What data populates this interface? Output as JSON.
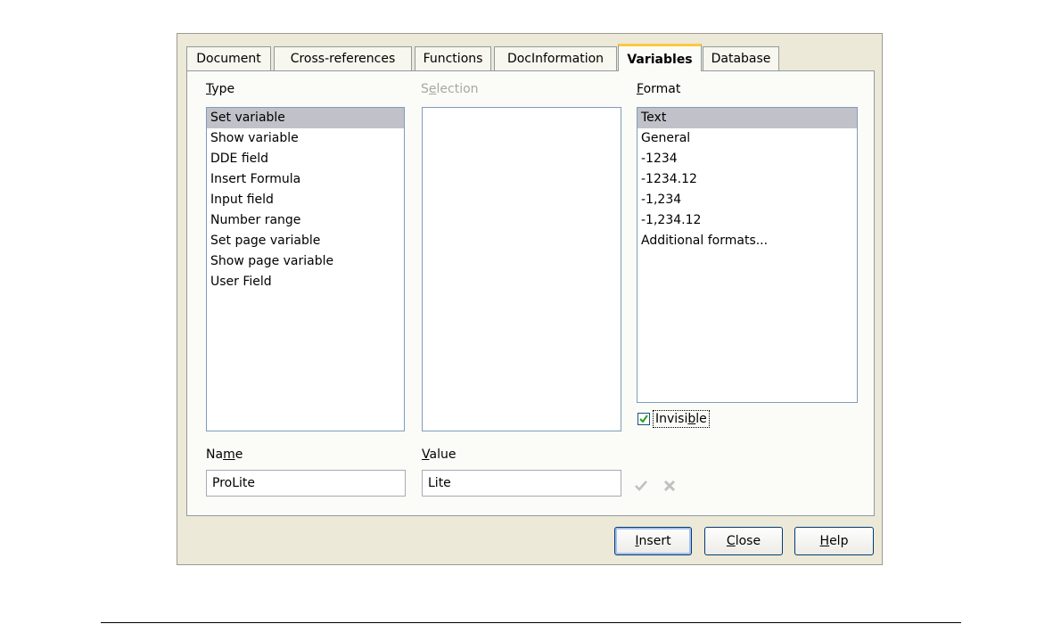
{
  "tabs": [
    {
      "label": "Document"
    },
    {
      "label": "Cross-references"
    },
    {
      "label": "Functions"
    },
    {
      "label": "DocInformation"
    },
    {
      "label": "Variables"
    },
    {
      "label": "Database"
    }
  ],
  "type": {
    "label_pre": "",
    "label_mnemonic": "T",
    "label_post": "ype",
    "items": [
      "Set variable",
      "Show variable",
      "DDE field",
      "Insert Formula",
      "Input field",
      "Number range",
      "Set page variable",
      "Show page variable",
      "User Field"
    ],
    "selected": "Set variable"
  },
  "selection": {
    "label_pre": "S",
    "label_mnemonic": "e",
    "label_post": "lection"
  },
  "format": {
    "label_pre": "",
    "label_mnemonic": "F",
    "label_post": "ormat",
    "items": [
      "Text",
      "General",
      "-1234",
      "-1234.12",
      "-1,234",
      "-1,234.12",
      "Additional formats..."
    ],
    "selected": "Text"
  },
  "invisible": {
    "label_pre": "Invisi",
    "label_mnemonic": "b",
    "label_post": "le",
    "checked": true
  },
  "name": {
    "label_pre": "Na",
    "label_mnemonic": "m",
    "label_post": "e",
    "value": "ProLite"
  },
  "value_field": {
    "label_pre": "",
    "label_mnemonic": "V",
    "label_post": "alue",
    "value": "Lite"
  },
  "buttons": {
    "insert": {
      "pre": "",
      "mnemonic": "I",
      "post": "nsert"
    },
    "close": {
      "pre": "",
      "mnemonic": "C",
      "post": "lose"
    },
    "help": {
      "pre": "",
      "mnemonic": "H",
      "post": "elp"
    }
  },
  "icons": {
    "apply": "checkmark-icon",
    "delete": "delete-x-icon"
  },
  "colors": {
    "active_tab_accent": "#ffc73c",
    "selection_bg": "#c1c1c9",
    "dialog_bg": "#ece9d8",
    "checkbox_check": "#21a121"
  }
}
